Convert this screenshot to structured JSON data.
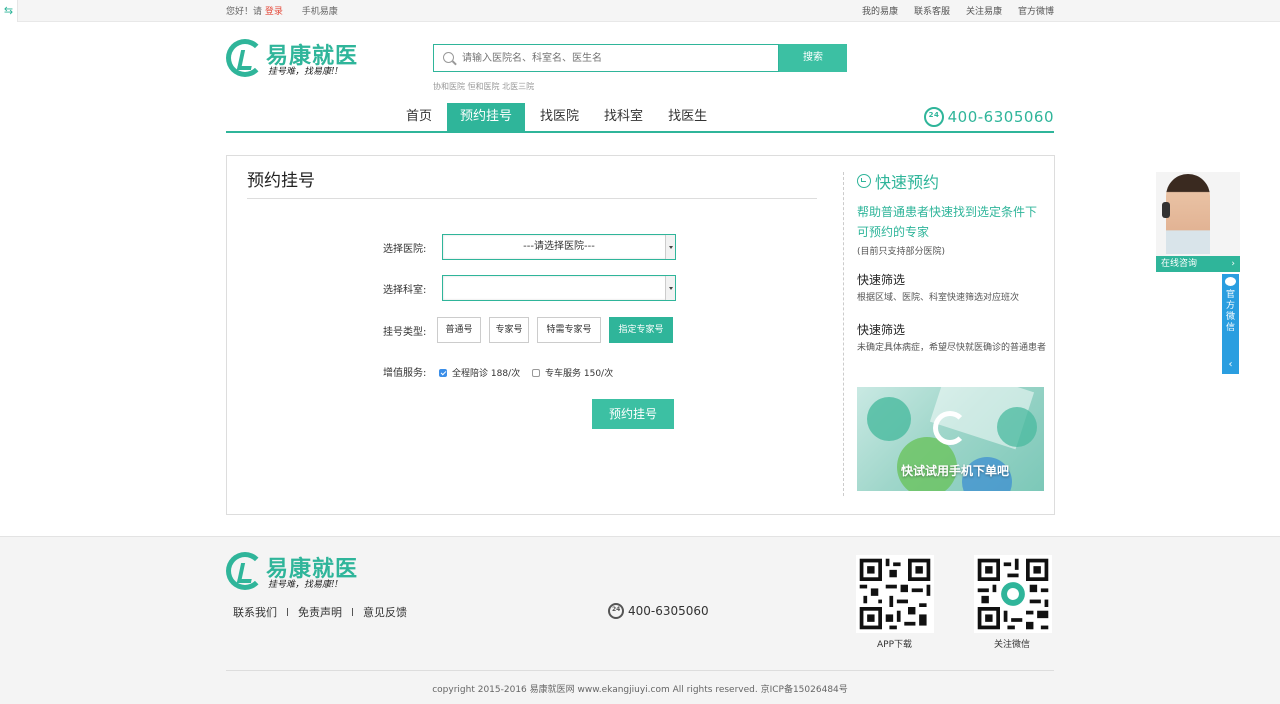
{
  "topbar": {
    "greeting": "您好！请",
    "login": "登录",
    "mobile": "手机易康",
    "links": [
      "我的易康",
      "联系客服",
      "关注易康",
      "官方微博"
    ]
  },
  "brand": {
    "name": "易康就医",
    "slogan": "挂号难，找易康!!"
  },
  "search": {
    "placeholder": "请输入医院名、科室名、医生名",
    "button": "搜索",
    "hot": "协和医院 恒和医院 北医三院"
  },
  "nav": {
    "items": [
      "首页",
      "预约挂号",
      "找医院",
      "找科室",
      "找医生"
    ],
    "active_index": 1,
    "phone": "400-6305060"
  },
  "form": {
    "title": "预约挂号",
    "hospital_label": "选择医院:",
    "hospital_value": "---请选择医院---",
    "department_label": "选择科室:",
    "department_value": "",
    "type_label": "挂号类型:",
    "types": [
      "普通号",
      "专家号",
      "特需专家号",
      "指定专家号"
    ],
    "active_type_index": 3,
    "service_label": "增值服务:",
    "services": [
      {
        "label": "全程陪诊 188/次",
        "checked": true
      },
      {
        "label": "专车服务 150/次",
        "checked": false
      }
    ],
    "submit": "预约挂号"
  },
  "side": {
    "title": "快速预约",
    "desc": "帮助普通患者快速找到选定条件下可预约的专家",
    "note": "(目前只支持部分医院)",
    "features": [
      {
        "title": "快速筛选",
        "desc": "根据区域、医院、科室快速筛选对应班次"
      },
      {
        "title": "快速筛选",
        "desc": "未确定具体病症，希望尽快就医确诊的普通患者"
      }
    ],
    "banner_text": "快试试用手机下单吧"
  },
  "widgets": {
    "chat": "在线咨询",
    "wechat": "官方微信",
    "wechat_arrow": "‹"
  },
  "footer": {
    "links": [
      "联系我们",
      "免责声明",
      "意见反馈"
    ],
    "phone": "400-6305060",
    "qr_app": "APP下载",
    "qr_wechat": "关注微信",
    "copyright": "copyright 2015-2016 易康就医网 www.ekangjiuyi.com All rights reserved. 京ICP备15026484号"
  },
  "colors": {
    "accent": "#2fb59a",
    "button": "#3cc0a3",
    "wechat_tab": "#2a9ee0"
  }
}
